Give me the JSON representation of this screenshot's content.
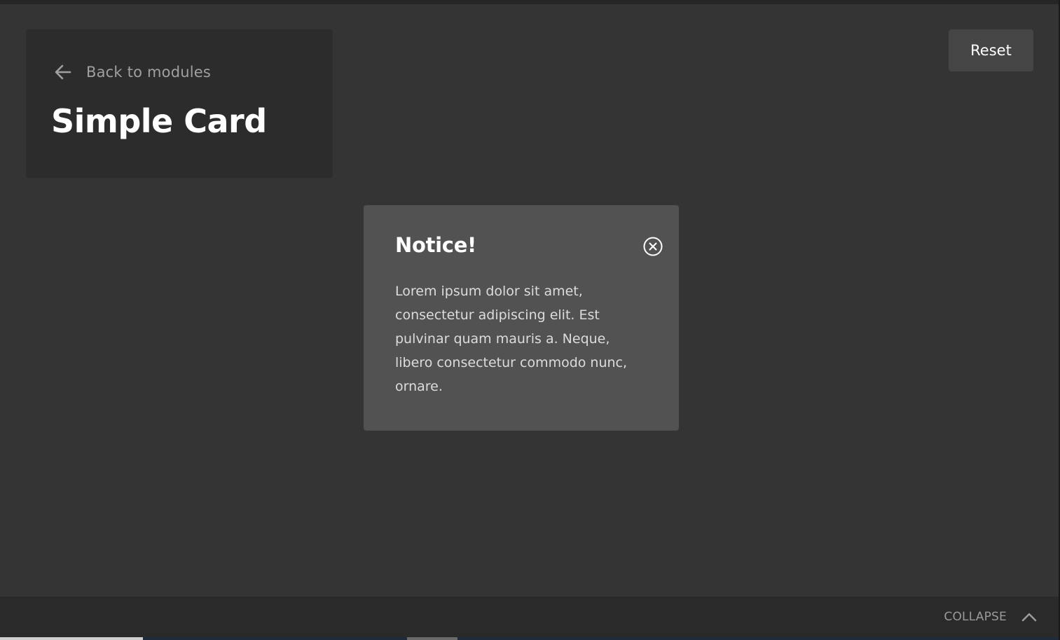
{
  "header": {
    "back_label": "Back to modules",
    "title": "Simple Card"
  },
  "toolbar": {
    "reset_label": "Reset"
  },
  "notice": {
    "title": "Notice!",
    "body": "Lorem ipsum dolor sit amet, consectetur adipiscing elit. Est pulvinar quam mauris a. Neque, libero consectetur commodo nunc, ornare."
  },
  "footer": {
    "collapse_label": "COLLAPSE"
  },
  "icons": {
    "back": "arrow-left-icon",
    "close": "close-circle-icon",
    "collapse": "chevron-up-icon"
  },
  "colors": {
    "background": "#343434",
    "header_card": "#2c2c2c",
    "notice_card": "#525252",
    "button": "#454545",
    "footer": "#2a2a2a"
  }
}
